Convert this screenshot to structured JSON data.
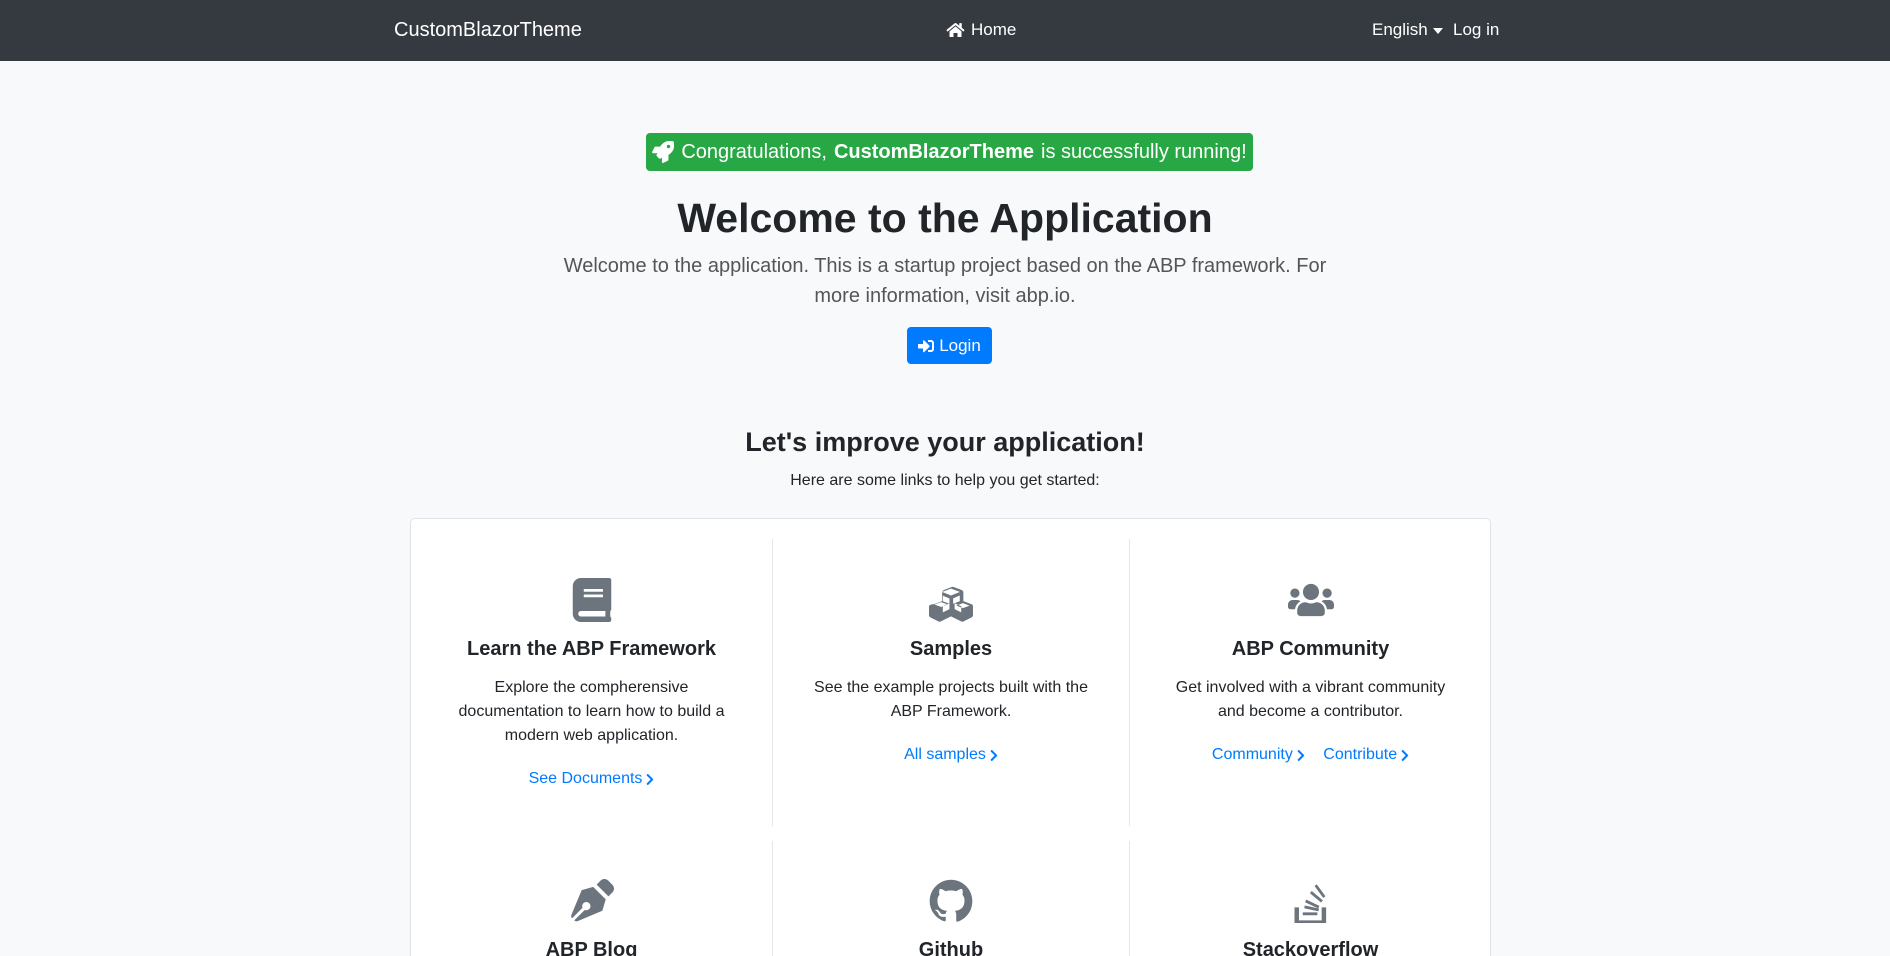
{
  "navbar": {
    "brand": "CustomBlazorTheme",
    "home_label": "Home",
    "language_label": "English",
    "login_label": "Log in"
  },
  "hero": {
    "congrats_prefix": "Congratulations,",
    "congrats_app": "CustomBlazorTheme",
    "congrats_suffix": "is successfully running!",
    "title": "Welcome to the Application",
    "lead": "Welcome to the application. This is a startup project based on the ABP framework. For more information, visit abp.io.",
    "login_button": "Login"
  },
  "improve": {
    "title": "Let's improve your application!",
    "subtitle": "Here are some links to help you get started:"
  },
  "cards": [
    {
      "icon": "book-icon",
      "title": "Learn the ABP Framework",
      "description": "Explore the compherensive documentation to learn how to build a modern web application.",
      "links": [
        "See Documents"
      ]
    },
    {
      "icon": "cubes-icon",
      "title": "Samples",
      "description": "See the example projects built with the ABP Framework.",
      "links": [
        "All samples"
      ]
    },
    {
      "icon": "users-icon",
      "title": "ABP Community",
      "description": "Get involved with a vibrant community and become a contributor.",
      "links": [
        "Community",
        "Contribute"
      ]
    },
    {
      "icon": "pen-nib-icon",
      "title": "ABP Blog"
    },
    {
      "icon": "github-icon",
      "title": "Github"
    },
    {
      "icon": "stack-overflow-icon",
      "title": "Stackoverflow"
    }
  ],
  "colors": {
    "navbar": "#343a40",
    "success": "#28a745",
    "primary": "#007bff",
    "icon": "#6c757d"
  }
}
